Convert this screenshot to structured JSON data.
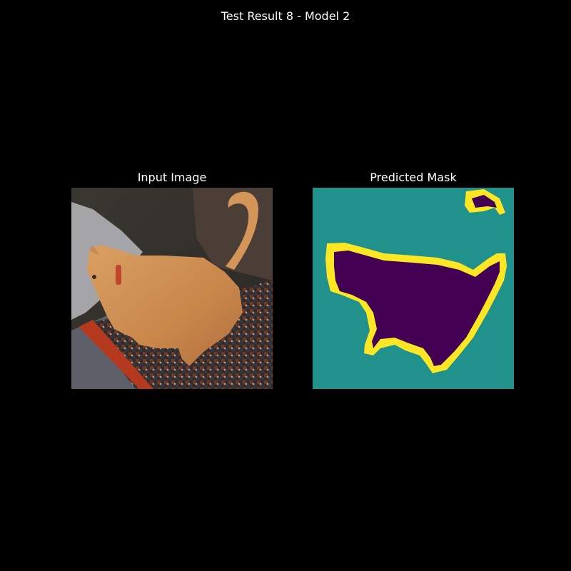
{
  "figure": {
    "title": "Test Result 8 - Model 2"
  },
  "panels": [
    {
      "title": "Input Image",
      "content": "photo of an orange tabby cat standing on a patterned rug"
    },
    {
      "title": "Predicted Mask",
      "content": "segmentation mask"
    }
  ],
  "mask_colors": {
    "background": "#21918c",
    "foreground": "#440154",
    "boundary": "#fde725"
  }
}
